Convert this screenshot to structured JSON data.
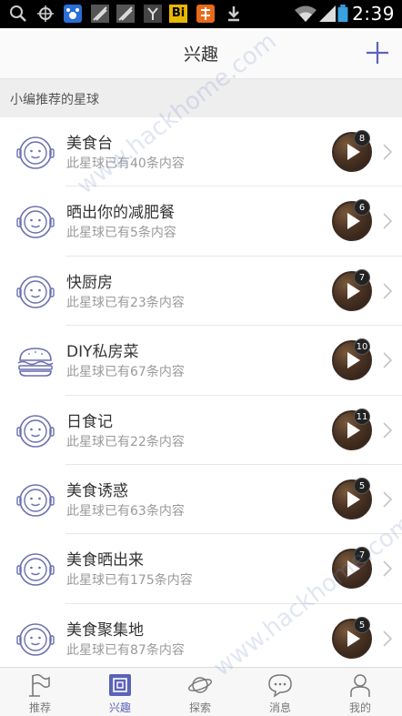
{
  "status_bar": {
    "time": "2:39",
    "icons": [
      "search-icon",
      "location-icon",
      "baidu-icon",
      "app-icon",
      "app-icon",
      "app-icon",
      "bi-icon",
      "app-icon",
      "download-icon",
      "wifi-icon",
      "signal-icon",
      "battery-icon"
    ],
    "bi_label": "Bi"
  },
  "header": {
    "title": "兴趣",
    "add_icon": "plus-icon"
  },
  "section": {
    "label": "小编推荐的星球"
  },
  "planets": [
    {
      "name": "美食台",
      "subtitle": "此星球已有40条内容",
      "badge": "8",
      "avatar": "astronaut-icon"
    },
    {
      "name": "晒出你的减肥餐",
      "subtitle": "此星球已有5条内容",
      "badge": "6",
      "avatar": "astronaut-icon"
    },
    {
      "name": "快厨房",
      "subtitle": "此星球已有23条内容",
      "badge": "7",
      "avatar": "astronaut-icon"
    },
    {
      "name": "DIY私房菜",
      "subtitle": "此星球已有67条内容",
      "badge": "10",
      "avatar": "burger-icon"
    },
    {
      "name": "日食记",
      "subtitle": "此星球已有22条内容",
      "badge": "11",
      "avatar": "astronaut-icon"
    },
    {
      "name": "美食诱惑",
      "subtitle": "此星球已有63条内容",
      "badge": "5",
      "avatar": "astronaut-icon"
    },
    {
      "name": "美食晒出来",
      "subtitle": "此星球已有175条内容",
      "badge": "7",
      "avatar": "astronaut-icon"
    },
    {
      "name": "美食聚集地",
      "subtitle": "此星球已有87条内容",
      "badge": "5",
      "avatar": "astronaut-icon"
    }
  ],
  "tabs": [
    {
      "label": "推荐",
      "icon": "flag-icon",
      "active": false
    },
    {
      "label": "兴趣",
      "icon": "interest-icon",
      "active": true
    },
    {
      "label": "探索",
      "icon": "planet-icon",
      "active": false
    },
    {
      "label": "消息",
      "icon": "message-icon",
      "active": false
    },
    {
      "label": "我的",
      "icon": "profile-icon",
      "active": false
    }
  ],
  "watermark": "www.hackhome.com",
  "colors": {
    "accent": "#5b63b8",
    "icon_line": "#6a6fb0",
    "section_bg": "#eeeeee",
    "status_bar": "#000000"
  }
}
